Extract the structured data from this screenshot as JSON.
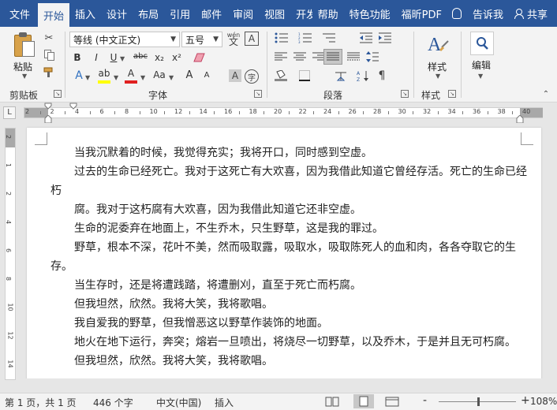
{
  "tabs": {
    "file": "文件",
    "home": "开始",
    "insert": "插入",
    "design": "设计",
    "layout": "布局",
    "references": "引用",
    "mailings": "邮件",
    "review": "审阅",
    "view": "视图",
    "developer": "开发工具",
    "help": "帮助",
    "special": "特色功能",
    "foxit": "福昕PDF",
    "tell": "告诉我",
    "share": "共享"
  },
  "ribbon": {
    "clipboard": {
      "label": "剪贴板",
      "paste": "粘贴"
    },
    "font": {
      "label": "字体",
      "font_name": "等线 (中文正文)",
      "font_size": "五号",
      "wen": "wén",
      "wen_char": "文",
      "a_box": "A",
      "bold": "B",
      "italic": "I",
      "underline": "U",
      "strike": "abc",
      "subscript": "x₂",
      "superscript": "x²",
      "text_effects": "A",
      "highlight": "ab",
      "font_color": "A",
      "change_case": "Aa",
      "grow": "A",
      "shrink": "A",
      "char_shade": "A",
      "enclose": "字"
    },
    "paragraph": {
      "label": "段落"
    },
    "styles": {
      "label": "样式",
      "button": "样式"
    },
    "editing": {
      "button": "编辑"
    }
  },
  "ruler": {
    "numbers": [
      "2",
      "2",
      "4",
      "6",
      "8",
      "10",
      "12",
      "14",
      "16",
      "18",
      "20",
      "22",
      "24",
      "26",
      "28",
      "30",
      "32",
      "34",
      "36",
      "38",
      "40"
    ],
    "vnumbers": [
      "2",
      "1",
      "2",
      "4",
      "6",
      "8",
      "10",
      "12",
      "14"
    ]
  },
  "document": {
    "paragraphs": [
      "当我沉默着的时候，我觉得充实；我将开口，同时感到空虚。",
      "过去的生命已经死亡。我对于这死亡有大欢喜，因为我借此知道它曾经存活。死亡的生命已经朽",
      "腐。我对于这朽腐有大欢喜，因为我借此知道它还非空虚。",
      "生命的泥委弃在地面上，不生乔木，只生野草，这是我的罪过。",
      "野草，根本不深，花叶不美，然而吸取露，吸取水，吸取陈死人的血和肉，各各夺取它的生存。",
      "当生存时，还是将遭践踏，将遭删刈，直至于死亡而朽腐。",
      "但我坦然，欣然。我将大笑，我将歌唱。",
      "我自爱我的野草，但我憎恶这以野草作装饰的地面。",
      "地火在地下运行，奔突；熔岩一旦喷出，将烧尽一切野草，以及乔木，于是并且无可朽腐。",
      "但我坦然，欣然。我将大笑，我将歌唱。"
    ]
  },
  "status": {
    "page": "第 1 页，共 1 页",
    "words": "446 个字",
    "language": "中文(中国)",
    "mode": "插入",
    "zoom": "108%",
    "minus": "-",
    "plus": "+"
  },
  "colors": {
    "accent": "#2b579a",
    "highlight": "#ffff00",
    "font_color": "#e02020"
  }
}
